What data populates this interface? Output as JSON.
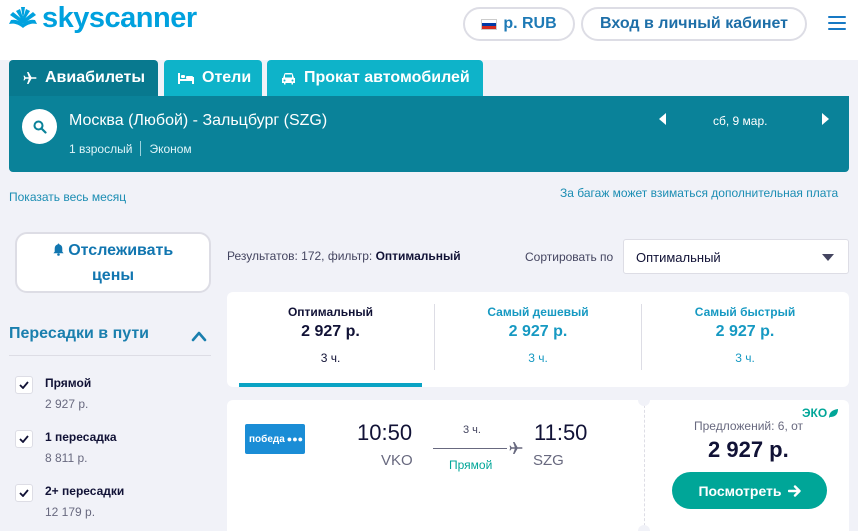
{
  "header": {
    "brand": "skyscanner",
    "currency": "р. RUB",
    "login": "Вход в личный кабинет"
  },
  "tabs": [
    {
      "label": "Авиабилеты",
      "icon": "plane-icon",
      "active": true
    },
    {
      "label": "Отели",
      "icon": "bed-icon",
      "active": false
    },
    {
      "label": "Прокат автомобилей",
      "icon": "car-icon",
      "active": false
    }
  ],
  "search": {
    "route": "Москва (Любой) - Зальцбург (SZG)",
    "passengers": "1 взрослый",
    "cabin": "Эконом",
    "date": "сб, 9 мар."
  },
  "links": {
    "month": "Показать весь месяц",
    "baggage": "За багаж может взиматься дополнительная плата"
  },
  "sidebar": {
    "track_line1": "Отслеживать",
    "track_line2": "цены",
    "stops_title": "Пересадки в пути",
    "stops": [
      {
        "label": "Прямой",
        "price": "2 927 р.",
        "checked": true
      },
      {
        "label": "1 пересадка",
        "price": "8 811 р.",
        "checked": true
      },
      {
        "label": "2+ пересадки",
        "price": "12 179 р.",
        "checked": true
      }
    ]
  },
  "results": {
    "summary_prefix": "Результатов: 172, фильтр: ",
    "summary_filter": "Оптимальный",
    "sort_label": "Сортировать по",
    "sort_value": "Оптимальный"
  },
  "sort_tabs": [
    {
      "title": "Оптимальный",
      "price": "2 927 р.",
      "duration": "3 ч."
    },
    {
      "title": "Самый дешевый",
      "price": "2 927 р.",
      "duration": "3 ч."
    },
    {
      "title": "Самый быстрый",
      "price": "2 927 р.",
      "duration": "3 ч."
    }
  ],
  "flight": {
    "airline": "победа",
    "dep_time": "10:50",
    "dep_code": "VKO",
    "arr_time": "11:50",
    "arr_code": "SZG",
    "duration": "3 ч.",
    "stops": "Прямой",
    "eco": "ЭКО",
    "offers": "Предложений: 6, от",
    "price": "2 927 р.",
    "button": "Посмотреть"
  },
  "colors": {
    "brand": "#00a1de",
    "tab_active": "#08798f",
    "tab_inactive": "#0eb3c9",
    "accent_green": "#00a698"
  }
}
